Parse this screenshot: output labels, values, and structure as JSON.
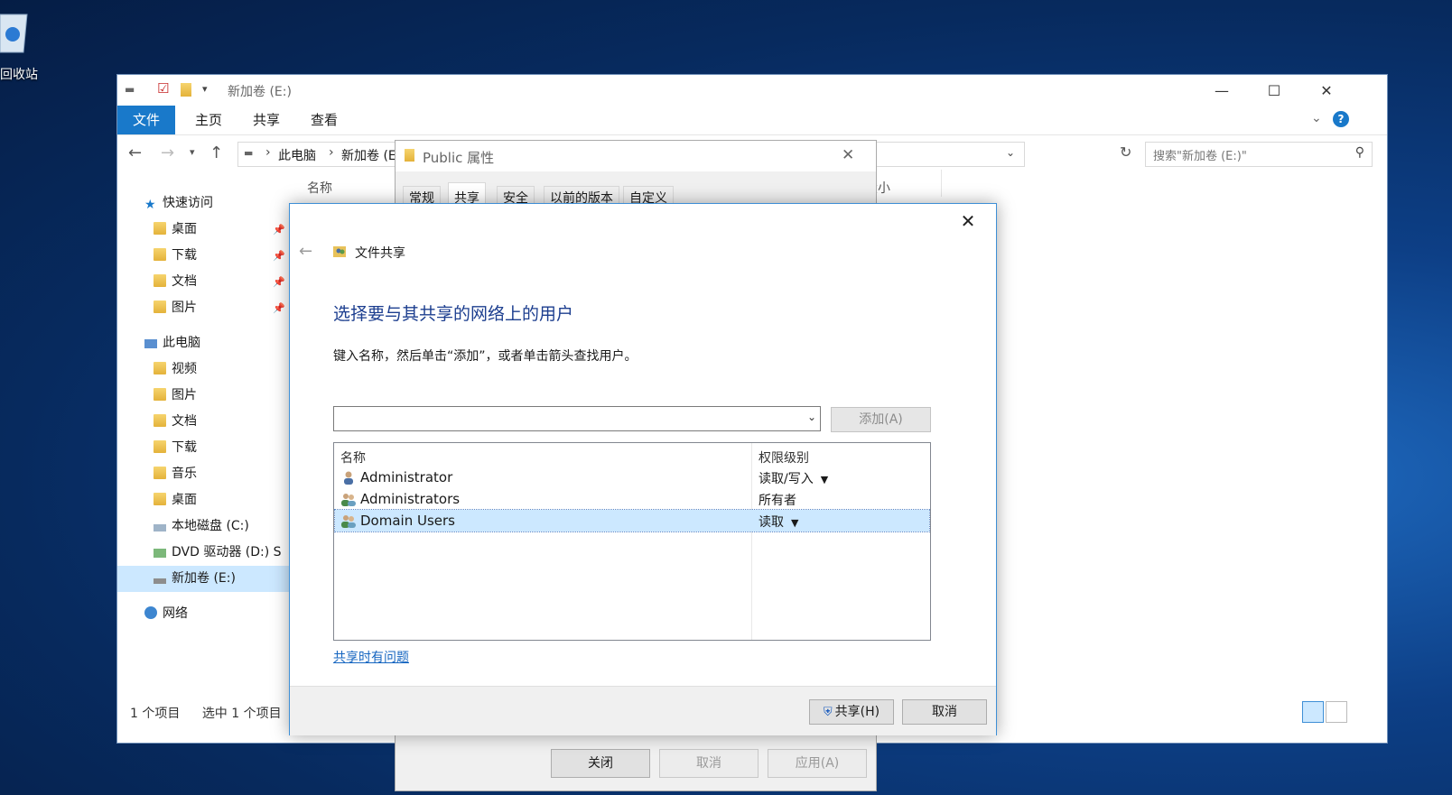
{
  "desktop": {
    "icon_label": "回收站"
  },
  "explorer": {
    "title": "新加卷 (E:)",
    "ribbon_tabs": [
      "文件",
      "主页",
      "共享",
      "查看"
    ],
    "address": [
      "此电脑",
      "新加卷 (E:"
    ],
    "search_placeholder": "搜索\"新加卷 (E:)\"",
    "nav": {
      "quick_access": "快速访问",
      "quick_items": [
        "桌面",
        "下载",
        "文档",
        "图片"
      ],
      "this_pc": "此电脑",
      "pc_items": [
        "视频",
        "图片",
        "文档",
        "下载",
        "音乐",
        "桌面"
      ],
      "drive_c": "本地磁盘 (C:)",
      "drive_d": "DVD 驱动器 (D:) S",
      "drive_e": "新加卷 (E:)",
      "network": "网络"
    },
    "columns": {
      "name": "名称",
      "size": "大小"
    },
    "status": {
      "count": "1 个项目",
      "selected": "选中 1 个项目"
    }
  },
  "properties": {
    "title": "Public 属性",
    "tabs": [
      "常规",
      "共享",
      "安全",
      "以前的版本",
      "自定义"
    ],
    "buttons": {
      "close": "关闭",
      "cancel": "取消",
      "apply": "应用(A)"
    }
  },
  "wizard": {
    "title": "文件共享",
    "heading": "选择要与其共享的网络上的用户",
    "instruction": "键入名称，然后单击“添加”，或者单击箭头查找用户。",
    "combo_value": "",
    "add_button": "添加(A)",
    "list_headers": {
      "name": "名称",
      "permission": "权限级别"
    },
    "users": [
      {
        "name": "Administrator",
        "permission": "读取/写入",
        "dropdown": true,
        "selected": false
      },
      {
        "name": "Administrators",
        "permission": "所有者",
        "dropdown": false,
        "selected": false
      },
      {
        "name": "Domain Users",
        "permission": "读取",
        "dropdown": true,
        "selected": true
      }
    ],
    "help_link": "共享时有问题",
    "share_button": "共享(H)",
    "cancel_button": "取消"
  },
  "colors": {
    "accent": "#1979ca",
    "selection": "#cce8ff",
    "heading": "#1c3e8f",
    "link": "#1565c0"
  }
}
